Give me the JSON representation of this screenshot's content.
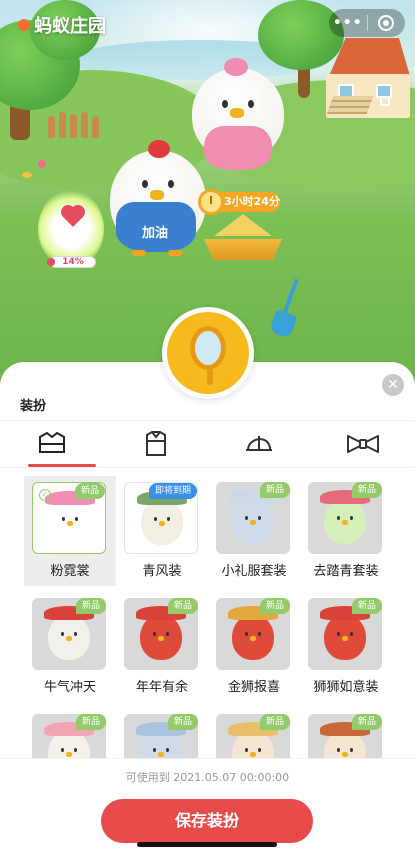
{
  "app": {
    "title": "蚂蚁庄园"
  },
  "capsule": {
    "more_icon": "more-dots-icon",
    "close_icon": "close-circle-icon"
  },
  "scene": {
    "egg_progress_text": "14%",
    "timer_text": "3小时24分",
    "overall_text": "加油"
  },
  "sheet": {
    "title": "装扮",
    "tabs": [
      {
        "name": "outfit",
        "icon": "outfit-icon",
        "active": true
      },
      {
        "name": "shirt",
        "icon": "shirt-icon",
        "active": false
      },
      {
        "name": "hat",
        "icon": "cap-icon",
        "active": false
      },
      {
        "name": "accessory",
        "icon": "bowtie-icon",
        "active": false
      }
    ],
    "items": [
      {
        "label": "粉霓裳",
        "badge": "新品",
        "selected": true
      },
      {
        "label": "青风装",
        "badge": "即将到期",
        "selected": false
      },
      {
        "label": "小礼服套装",
        "badge": "新品",
        "selected": false
      },
      {
        "label": "去踏青套装",
        "badge": "新品",
        "selected": false
      },
      {
        "label": "牛气冲天",
        "badge": "新品",
        "selected": false
      },
      {
        "label": "年年有余",
        "badge": "新品",
        "selected": false
      },
      {
        "label": "金狮报喜",
        "badge": "新品",
        "selected": false
      },
      {
        "label": "狮狮如意装",
        "badge": "新品",
        "selected": false
      },
      {
        "label": "",
        "badge": "新品",
        "selected": false
      },
      {
        "label": "",
        "badge": "新品",
        "selected": false
      },
      {
        "label": "",
        "badge": "新品",
        "selected": false
      },
      {
        "label": "",
        "badge": "新品",
        "selected": false
      }
    ]
  },
  "footer": {
    "valid_text": "可使用到 2021.05.07 00:00:00",
    "save_label": "保存装扮"
  },
  "colors": {
    "accent": "#e84b4b",
    "new_badge": "#93cb6b",
    "expire_badge": "#3a8fe8"
  }
}
